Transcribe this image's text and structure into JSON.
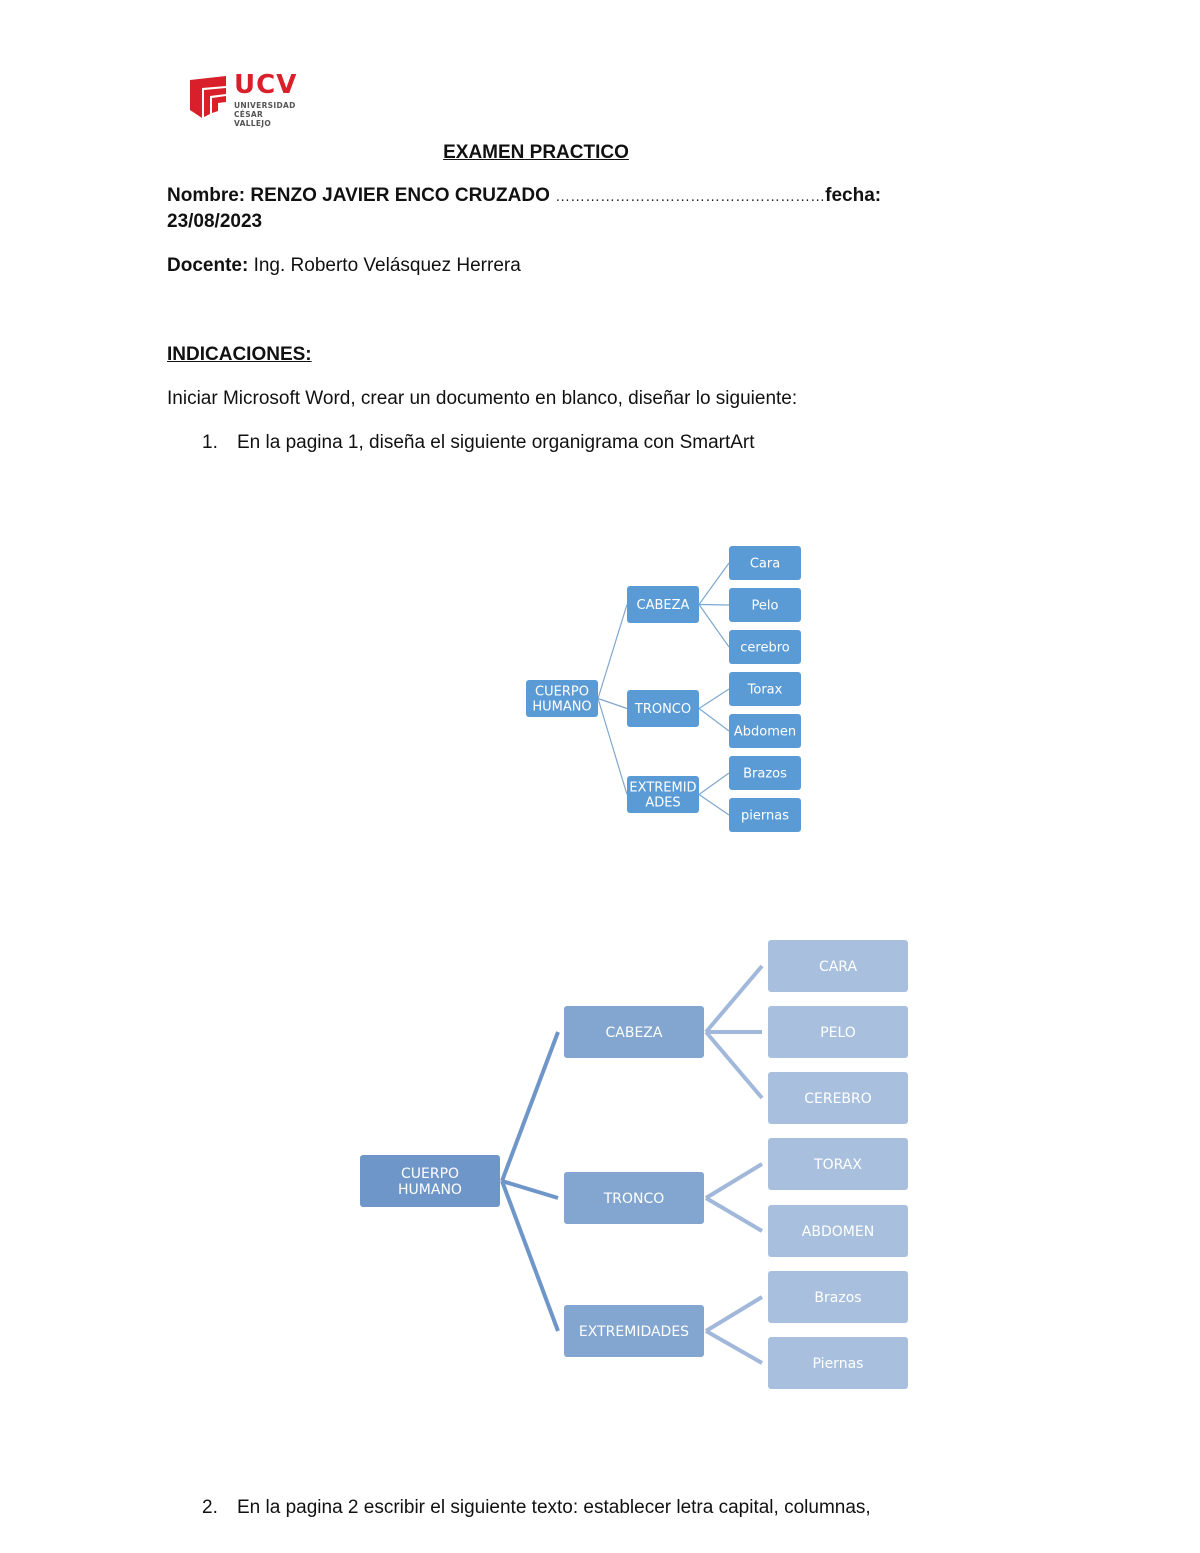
{
  "logo": {
    "brand": "UCV",
    "line1": "UNIVERSIDAD",
    "line2": "CÉSAR VALLEJO",
    "colors": {
      "red": "#d81f2a",
      "gray": "#555555"
    }
  },
  "header": {
    "title": "EXAMEN PRACTICO",
    "name_label": "Nombre:",
    "name_value": "RENZO JAVIER ENCO CRUZADO",
    "dots": "………………………………………………",
    "date_label": "fecha:",
    "date_value": "23/08/2023",
    "teacher_label": "Docente:",
    "teacher_value": "Ing. Roberto Velásquez Herrera"
  },
  "instructions": {
    "heading": "INDICACIONES:",
    "intro": "Iniciar Microsoft Word, crear un documento en blanco, diseñar lo siguiente:",
    "items": [
      {
        "number": "1.",
        "text": "En la pagina 1, diseña el siguiente organigrama con SmartArt"
      },
      {
        "number": "2.",
        "text": "En la pagina 2 escribir el siguiente texto: establecer letra capital, columnas,"
      }
    ]
  },
  "diagram_reference": {
    "colors": {
      "box": "#5b9bd5",
      "line": "#7fa7cf",
      "text": "#ffffff"
    },
    "root": {
      "label": [
        "CUERPO",
        "HUMANO"
      ]
    },
    "branches": [
      {
        "label": [
          "CABEZA"
        ],
        "children": [
          "Cara",
          "Pelo",
          "cerebro"
        ]
      },
      {
        "label": [
          "TRONCO"
        ],
        "children": [
          "Torax",
          "Abdomen"
        ]
      },
      {
        "label": [
          "EXTREMID",
          "ADES"
        ],
        "children": [
          "Brazos",
          "piernas"
        ]
      }
    ]
  },
  "diagram_answer": {
    "colors": {
      "root": "#6f96c9",
      "branch": "#82a6d0",
      "leaf": "#a8c0de",
      "root_line": "#6f96c9",
      "leaf_line": "#a2b8da",
      "text": "#ffffff"
    },
    "root": {
      "label": [
        "CUERPO",
        "HUMANO"
      ]
    },
    "branches": [
      {
        "label": [
          "CABEZA"
        ],
        "children": [
          "CARA",
          "PELO",
          "CEREBRO"
        ]
      },
      {
        "label": [
          "TRONCO"
        ],
        "children": [
          "TORAX",
          "ABDOMEN"
        ]
      },
      {
        "label": [
          "EXTREMIDADES"
        ],
        "children": [
          "Brazos",
          "Piernas"
        ]
      }
    ]
  }
}
